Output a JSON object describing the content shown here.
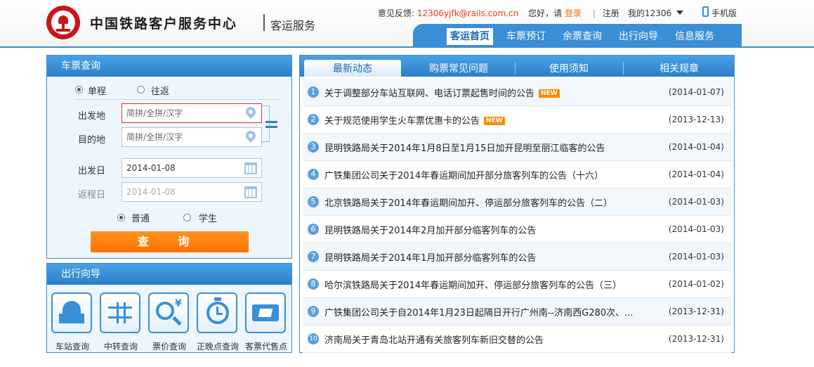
{
  "header": {
    "logo_title": "中国铁路客户服务中心",
    "logo_sub": "客运服务",
    "feedback_label": "意见反馈:",
    "feedback_email": "12306yjfk@rails.com.cn",
    "hello": "您好，请",
    "login": "登录",
    "separator": "|",
    "register": "注册",
    "my12306": "我的12306",
    "mobile": "手机版",
    "nav": [
      "客运首页",
      "车票预订",
      "余票查询",
      "出行向导",
      "信息服务"
    ]
  },
  "ticket_query": {
    "title": "车票查询",
    "trip_types": [
      "单程",
      "往返"
    ],
    "from_label": "出发地",
    "from_placeholder": "简拼/全拼/汉字",
    "to_label": "目的地",
    "to_placeholder": "简拼/全拼/汉字",
    "depart_label": "出发日",
    "depart_value": "2014-01-08",
    "return_label": "返程日",
    "return_value": "2014-01-08",
    "ticket_types": [
      "普通",
      "学生"
    ],
    "submit": "查 询"
  },
  "guide": {
    "title": "出行向导",
    "items": [
      "车站查询",
      "中转查询",
      "票价查询",
      "正晚点查询",
      "客票代售点"
    ]
  },
  "news": {
    "tabs": [
      "最新动态",
      "购票常见问题",
      "使用须知",
      "相关规章"
    ],
    "badge": "NEW",
    "items": [
      {
        "num": "1",
        "title": "关于调整部分车站互联网、电话订票起售时间的公告",
        "date": "(2014-01-07)",
        "is_new": true
      },
      {
        "num": "2",
        "title": "关于规范使用学生火车票优惠卡的公告",
        "date": "(2013-12-13)",
        "is_new": true
      },
      {
        "num": "3",
        "title": "昆明铁路局关于2014年1月8日至1月15日加开昆明至丽江临客的公告",
        "date": "(2014-01-04)",
        "is_new": false
      },
      {
        "num": "4",
        "title": "广铁集团公司关于2014年春运期间加开部分旅客列车的公告（十六）",
        "date": "(2014-01-04)",
        "is_new": false
      },
      {
        "num": "5",
        "title": "北京铁路局关于2014年春运期间加开、停运部分旅客列车的公告（二）",
        "date": "(2014-01-03)",
        "is_new": false
      },
      {
        "num": "6",
        "title": "昆明铁路局关于2014年2月加开部分临客列车的公告",
        "date": "(2014-01-03)",
        "is_new": false
      },
      {
        "num": "7",
        "title": "昆明铁路局关于2014年1月加开部分临客列车的公告",
        "date": "(2014-01-03)",
        "is_new": false
      },
      {
        "num": "8",
        "title": "哈尔滨铁路局关于2014年春运期间加开、停运部分旅客列车的公告（三）",
        "date": "(2014-01-02)",
        "is_new": false
      },
      {
        "num": "9",
        "title": "广铁集团公司关于自2014年1月23日起隔日开行广州南--济南西G280次、...",
        "date": "(2013-12-31)",
        "is_new": false
      },
      {
        "num": "10",
        "title": "济南局关于青岛北站开通有关旅客列车新旧交替的公告",
        "date": "(2013-12-31)",
        "is_new": false
      }
    ]
  },
  "colors": {
    "brand_blue": "#3a8fd6",
    "brand_red": "#c8161d",
    "link_red": "#f03c14",
    "button_orange": "#ff7200"
  },
  "icons": [
    "railway-logo-icon",
    "chevron-down-icon",
    "mobile-phone-icon",
    "location-pin-icon",
    "calendar-icon",
    "swap-icon",
    "station-icon",
    "transfer-icon",
    "price-search-icon",
    "clock-icon",
    "ticket-agent-icon"
  ]
}
